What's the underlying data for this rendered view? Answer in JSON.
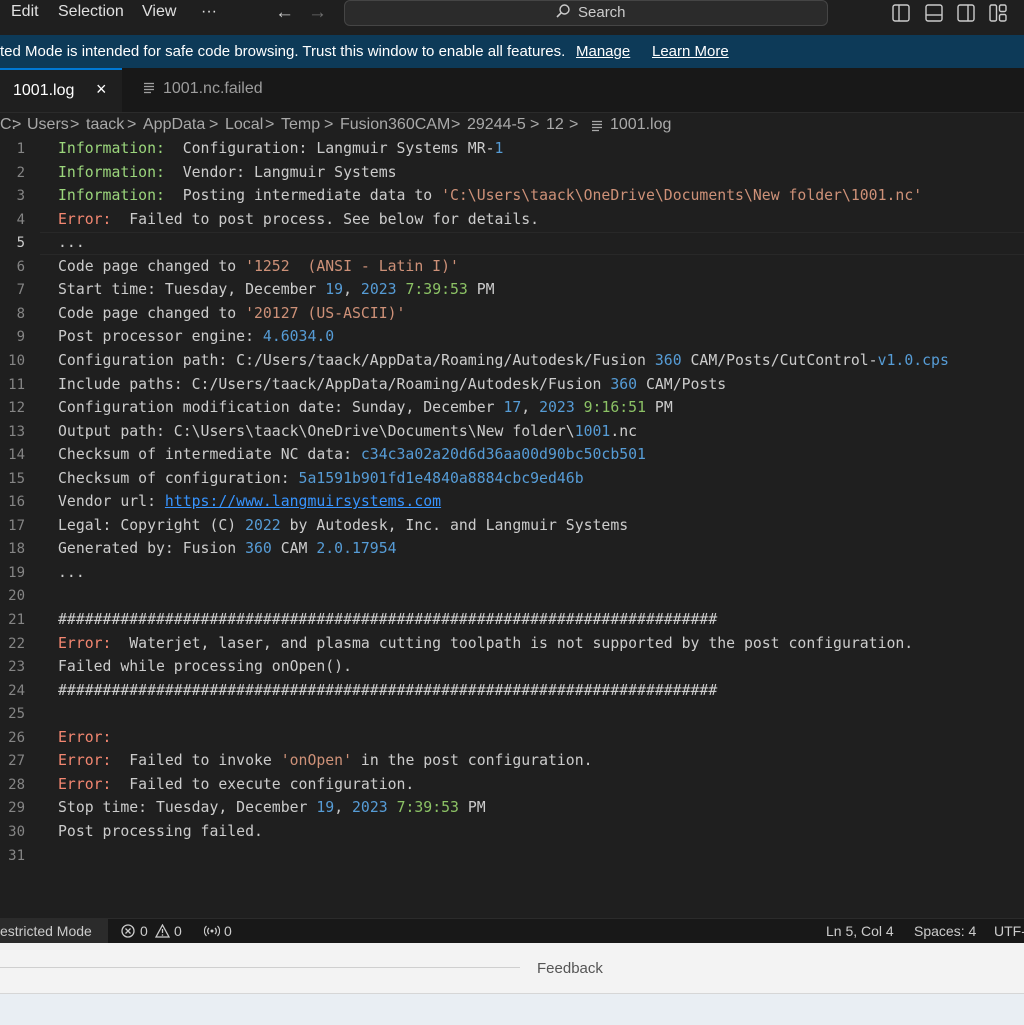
{
  "menu": {
    "items": [
      "Edit",
      "Selection",
      "View",
      "···"
    ]
  },
  "search": {
    "label": "Search"
  },
  "banner": {
    "message": "ted Mode is intended for safe code browsing. Trust this window to enable all features.",
    "manage_label": "Manage",
    "learn_more_label": "Learn More"
  },
  "tabs": [
    {
      "label": "1001.log",
      "active": true,
      "close_label": "×"
    },
    {
      "label": "1001.nc.failed",
      "active": false
    }
  ],
  "breadcrumb": [
    "C:",
    "Users",
    "taack",
    "AppData",
    "Local",
    "Temp",
    "Fusion360CAM",
    "29244-5",
    "12",
    "1001.log"
  ],
  "breadcrumb_separator": ">",
  "editor": {
    "current_line": 5,
    "lines": [
      [
        [
          "info",
          "Information:"
        ],
        [
          "",
          "  Configuration: Langmuir Systems MR-"
        ],
        [
          "num",
          "1"
        ]
      ],
      [
        [
          "info",
          "Information:"
        ],
        [
          "",
          "  Vendor: Langmuir Systems"
        ]
      ],
      [
        [
          "info",
          "Information:"
        ],
        [
          "",
          "  Posting intermediate data to "
        ],
        [
          "str",
          "'C:\\Users\\taack\\OneDrive\\Documents\\New folder\\1001.nc'"
        ]
      ],
      [
        [
          "err",
          "Error:"
        ],
        [
          "",
          "  Failed to post process. See below for details."
        ]
      ],
      [
        [
          "",
          "..."
        ]
      ],
      [
        [
          "",
          "Code page changed to "
        ],
        [
          "str",
          "'1252  (ANSI - Latin I)'"
        ]
      ],
      [
        [
          "",
          "Start time: Tuesday, December "
        ],
        [
          "num",
          "19"
        ],
        [
          "",
          ", "
        ],
        [
          "num",
          "2023"
        ],
        [
          "time",
          " 7:39:53"
        ],
        [
          "",
          " PM"
        ]
      ],
      [
        [
          "",
          "Code page changed to "
        ],
        [
          "str",
          "'20127 (US-ASCII)'"
        ]
      ],
      [
        [
          "",
          "Post processor engine: "
        ],
        [
          "num",
          "4.6034.0"
        ]
      ],
      [
        [
          "",
          "Configuration path: C:/Users/taack/AppData/Roaming/Autodesk/Fusion "
        ],
        [
          "num",
          "360"
        ],
        [
          "",
          " CAM/Posts/CutControl-"
        ],
        [
          "num",
          "v1.0.cps"
        ]
      ],
      [
        [
          "",
          "Include paths: C:/Users/taack/AppData/Roaming/Autodesk/Fusion "
        ],
        [
          "num",
          "360"
        ],
        [
          "",
          " CAM/Posts"
        ]
      ],
      [
        [
          "",
          "Configuration modification date: Sunday, December "
        ],
        [
          "num",
          "17"
        ],
        [
          "",
          ", "
        ],
        [
          "num",
          "2023"
        ],
        [
          "time",
          " 9:16:51"
        ],
        [
          "",
          " PM"
        ]
      ],
      [
        [
          "",
          "Output path: C:\\Users\\taack\\OneDrive\\Documents\\New folder\\"
        ],
        [
          "num",
          "1001"
        ],
        [
          "",
          ".nc"
        ]
      ],
      [
        [
          "",
          "Checksum of intermediate NC data: "
        ],
        [
          "num",
          "c34c3a02a20d6d36aa00d90bc50cb501"
        ]
      ],
      [
        [
          "",
          "Checksum of configuration: "
        ],
        [
          "num",
          "5a1591b901fd1e4840a8884cbc9ed46b"
        ]
      ],
      [
        [
          "",
          "Vendor url: "
        ],
        [
          "url",
          "https://www.langmuirsystems.com"
        ]
      ],
      [
        [
          "",
          "Legal: Copyright (C) "
        ],
        [
          "num",
          "2022"
        ],
        [
          "",
          " by Autodesk, Inc. and Langmuir Systems"
        ]
      ],
      [
        [
          "",
          "Generated by: Fusion "
        ],
        [
          "num",
          "360"
        ],
        [
          "",
          " CAM "
        ],
        [
          "num",
          "2.0.17954"
        ]
      ],
      [
        [
          "",
          "..."
        ]
      ],
      [
        [
          "",
          ""
        ]
      ],
      [
        [
          "",
          "##########################################################################"
        ]
      ],
      [
        [
          "err",
          "Error:"
        ],
        [
          "",
          "  Waterjet, laser, and plasma cutting toolpath is not supported by the post configuration."
        ]
      ],
      [
        [
          "",
          "Failed while processing onOpen()."
        ]
      ],
      [
        [
          "",
          "##########################################################################"
        ]
      ],
      [
        [
          "",
          ""
        ]
      ],
      [
        [
          "err",
          "Error:"
        ]
      ],
      [
        [
          "err",
          "Error:"
        ],
        [
          "",
          "  Failed to invoke "
        ],
        [
          "str",
          "'onOpen'"
        ],
        [
          "",
          " in the post configuration."
        ]
      ],
      [
        [
          "err",
          "Error:"
        ],
        [
          "",
          "  Failed to execute configuration."
        ]
      ],
      [
        [
          "",
          "Stop time: Tuesday, December "
        ],
        [
          "num",
          "19"
        ],
        [
          "",
          ", "
        ],
        [
          "num",
          "2023"
        ],
        [
          "time",
          " 7:39:53"
        ],
        [
          "",
          " PM"
        ]
      ],
      [
        [
          "",
          "Post processing failed."
        ]
      ],
      [
        [
          "",
          ""
        ]
      ]
    ]
  },
  "status": {
    "restricted_mode": "estricted Mode",
    "errors": "0",
    "warnings": "0",
    "ports": "0",
    "cursor": "Ln 5, Col 4",
    "spaces": "Spaces: 4",
    "encoding": "UTF-"
  },
  "bottom_panel": {
    "feedback_label": "Feedback"
  },
  "colors": {
    "banner_bg": "#0d3a58",
    "editor_bg": "#1f1f1f",
    "info_keyword": "#9bd67c",
    "error_keyword": "#f48771",
    "number": "#569cd6",
    "string": "#ce9178",
    "accent": "#0078d4"
  }
}
